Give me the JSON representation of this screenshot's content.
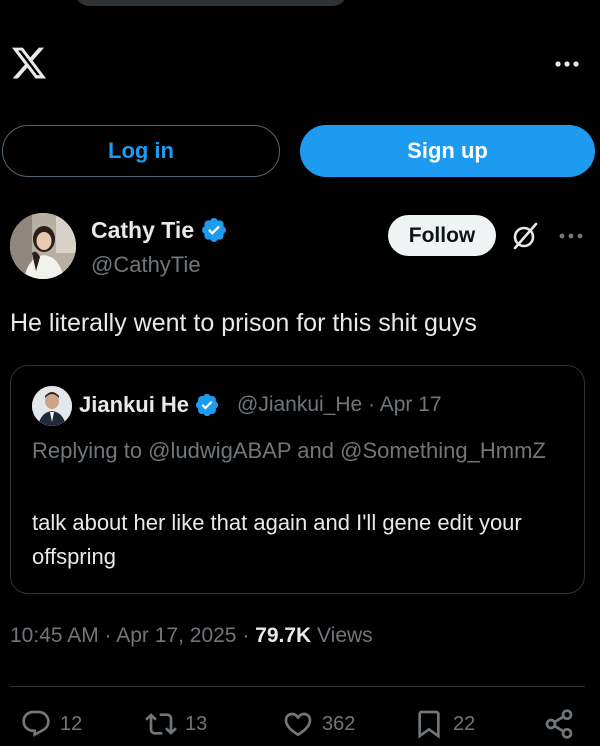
{
  "header": {
    "logo_icon": "x-logo-icon",
    "more_icon": "more-horizontal-icon"
  },
  "auth": {
    "login_label": "Log in",
    "signup_label": "Sign up"
  },
  "tweet": {
    "author_name": "Cathy Tie",
    "author_handle": "@CathyTie",
    "follow_label": "Follow",
    "text": "He literally went to prison for this shit guys",
    "timestamp": "10:45 AM · Apr 17, 2025 · ",
    "views_count": "79.7K",
    "views_label": " Views"
  },
  "quoted": {
    "author_name": "Jiankui He",
    "author_handle": "@Jiankui_He",
    "date": "Apr 17",
    "replying_to": "Replying to @ludwigABAP and @Something_HmmZ",
    "text": "talk about her like that again and I'll gene edit your offspring"
  },
  "actions": {
    "replies": "12",
    "reposts": "13",
    "likes": "362",
    "bookmarks": "22"
  },
  "colors": {
    "accent": "#1d9bf0",
    "background": "#000000",
    "text": "#e7e9ea",
    "muted": "#71767b"
  }
}
